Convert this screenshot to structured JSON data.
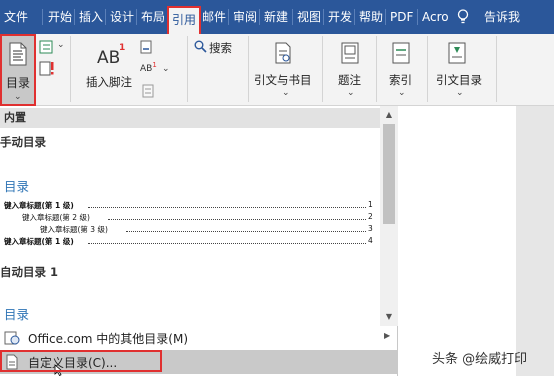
{
  "tabs": [
    "文件",
    "开始",
    "插入",
    "设计",
    "布局",
    "引用",
    "邮件",
    "审阅",
    "新建",
    "视图",
    "开发",
    "帮助",
    "PDF",
    "Acro"
  ],
  "active_tab": "引用",
  "tell_me": "告诉我",
  "ribbon": {
    "toc_label": "目录",
    "insert_footnote": "插入脚注",
    "search": "搜索",
    "citations": "引文与书目",
    "captions": "题注",
    "index": "索引",
    "table_of_authorities": "引文目录"
  },
  "gallery": {
    "section": "内置",
    "manual_title": "手动目录",
    "auto_title": "自动目录 1",
    "toc_heading": "目录",
    "entries": [
      {
        "text": "键入章标题(第 1 级)",
        "page": "1"
      },
      {
        "text": "键入章标题(第 2 级)",
        "page": "2"
      },
      {
        "text": "键入章标题(第 3 级)",
        "page": "3"
      },
      {
        "text": "键入章标题(第 1 级)",
        "page": "4"
      }
    ],
    "toc_heading_2": "目录"
  },
  "menu": {
    "more_online": "Office.com 中的其他目录(M)",
    "custom_toc": "自定义目录(C)..."
  },
  "watermark": "头条 @绘威打印"
}
